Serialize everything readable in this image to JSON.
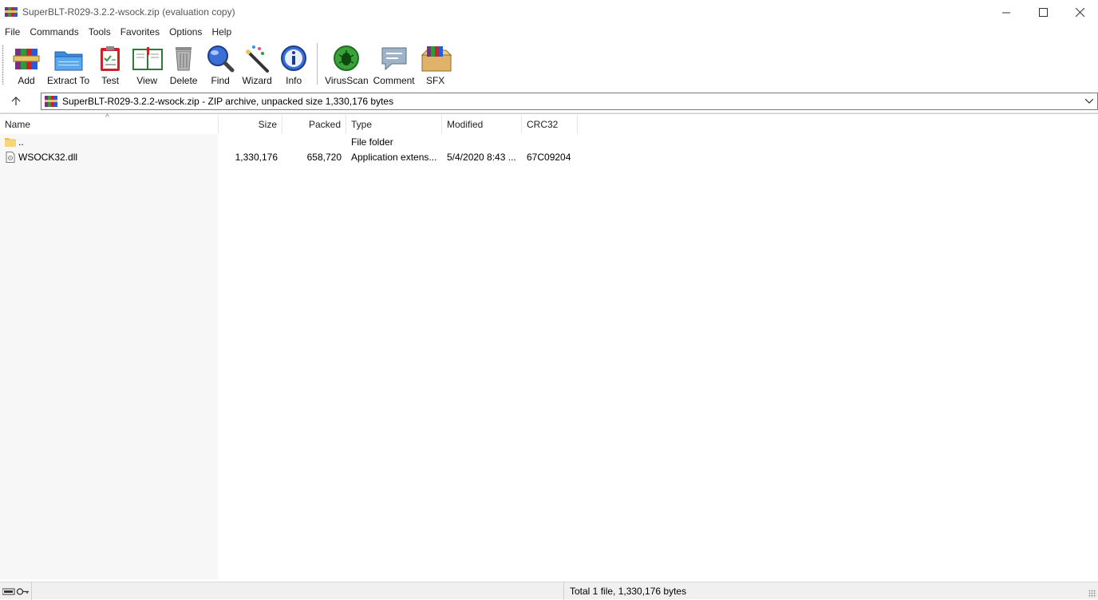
{
  "window": {
    "title": "SuperBLT-R029-3.2.2-wsock.zip (evaluation copy)",
    "minimize": "—",
    "maximize": "☐",
    "close": "✕"
  },
  "menu": {
    "items": [
      "File",
      "Commands",
      "Tools",
      "Favorites",
      "Options",
      "Help"
    ]
  },
  "toolbar": {
    "add": "Add",
    "extract": "Extract To",
    "test": "Test",
    "view": "View",
    "delete": "Delete",
    "find": "Find",
    "wizard": "Wizard",
    "info": "Info",
    "virusscan": "VirusScan",
    "comment": "Comment",
    "sfx": "SFX"
  },
  "address": {
    "text": "SuperBLT-R029-3.2.2-wsock.zip - ZIP archive, unpacked size 1,330,176 bytes"
  },
  "columns": {
    "name": "Name",
    "size": "Size",
    "packed": "Packed",
    "type": "Type",
    "modified": "Modified",
    "crc": "CRC32"
  },
  "rows": [
    {
      "name": "..",
      "size": "",
      "packed": "",
      "type": "File folder",
      "modified": "",
      "crc": "",
      "icon": "folder-icon"
    },
    {
      "name": "WSOCK32.dll",
      "size": "1,330,176",
      "packed": "658,720",
      "type": "Application extens...",
      "modified": "5/4/2020 8:43 ...",
      "crc": "67C09204",
      "icon": "dll-file-icon"
    }
  ],
  "status": {
    "total": "Total 1 file, 1,330,176 bytes"
  },
  "colors": {
    "accent": "#0078d7",
    "list_name_bg": "#f7f7f7"
  }
}
